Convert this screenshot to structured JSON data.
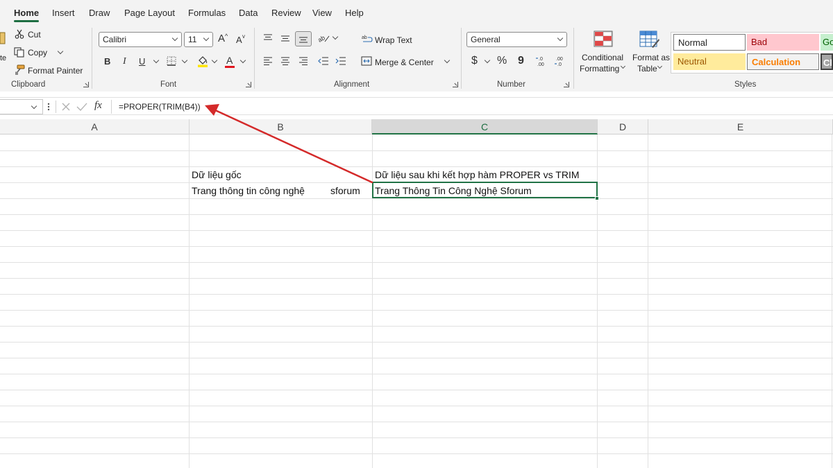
{
  "menu": {
    "tabs": [
      "Home",
      "Insert",
      "Draw",
      "Page Layout",
      "Formulas",
      "Data",
      "Review",
      "View",
      "Help"
    ],
    "active": "Home"
  },
  "ribbon": {
    "clipboard": {
      "paste_partial": "te",
      "cut": "Cut",
      "copy": "Copy",
      "format_painter": "Format Painter",
      "label": "Clipboard"
    },
    "font": {
      "name": "Calibri",
      "size": "11",
      "grow": "A",
      "shrink": "A",
      "bold": "B",
      "italic": "I",
      "underline": "U",
      "font_color_letter": "A",
      "label": "Font"
    },
    "alignment": {
      "wrap_text": "Wrap Text",
      "merge_center": "Merge & Center",
      "label": "Alignment"
    },
    "number": {
      "format": "General",
      "currency": "$",
      "percent": "%",
      "comma": "9",
      "label": "Number"
    },
    "styles": {
      "conditional_formatting": [
        "Conditional",
        "Formatting"
      ],
      "format_as_table": [
        "Format as",
        "Table"
      ],
      "normal": "Normal",
      "bad": "Bad",
      "good_partial": "Go",
      "neutral": "Neutral",
      "calculation": "Calculation",
      "check_partial": "Ch",
      "label": "Styles"
    }
  },
  "formula_bar": {
    "fx": "fx",
    "formula": "=PROPER(TRIM(B4))"
  },
  "sheet": {
    "columns": [
      "A",
      "B",
      "C",
      "D",
      "E"
    ],
    "selected_column": "C",
    "cells": {
      "B3": "Dữ liệu gốc",
      "C3": "Dữ liệu sau khi kết hợp hàm PROPER vs TRIM",
      "B4_left": "Trang thông tin công nghệ",
      "B4_right": "sforum",
      "C4": "Trang Thông Tin Công Nghệ Sforum"
    }
  },
  "colors": {
    "accent": "#217346",
    "arrow": "#d42a2a",
    "bad_bg": "#ffc7ce",
    "bad_text": "#9c0006",
    "neutral_bg": "#ffeb9c",
    "neutral_text": "#9c5700",
    "calc_text": "#fa7d00",
    "good_bg": "#c6efce"
  }
}
